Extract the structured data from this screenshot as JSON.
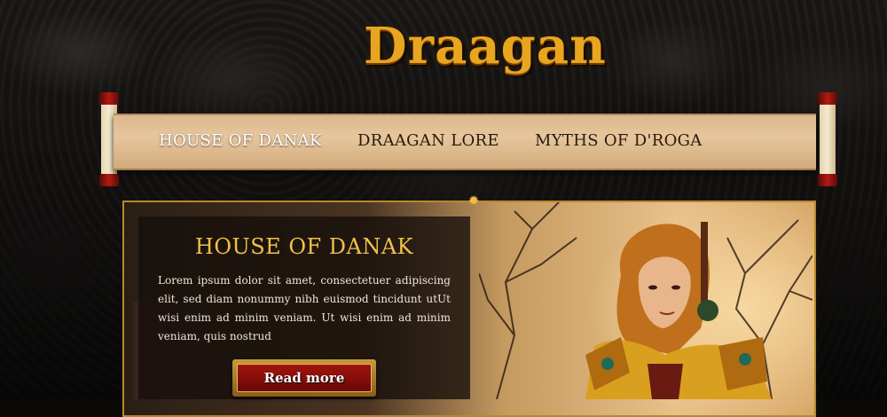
{
  "brand": {
    "logo_text": "Draagan"
  },
  "nav": {
    "items": [
      {
        "label": "HOUSE OF DANAK",
        "active": true
      },
      {
        "label": "DRAAGAN LORE",
        "active": false
      },
      {
        "label": "MYTHS OF D'ROGA",
        "active": false
      }
    ]
  },
  "feature": {
    "title": "HOUSE OF DANAK",
    "body": "Lorem ipsum dolor sit amet, consectetuer adipiscing elit, sed diam nonummy nibh euismod tincidunt utUt wisi enim ad minim veniam. Ut wisi enim ad minim veniam, quis nostrud",
    "button_label": "Read more"
  },
  "colors": {
    "accent_gold": "#f2c14a",
    "nav_active": "#ffffff",
    "nav_inactive": "#2a1a0c",
    "button_red": "#a3140e",
    "frame_border": "#b58a2a"
  },
  "icons": {
    "ornament": "sun-ornament-icon"
  }
}
